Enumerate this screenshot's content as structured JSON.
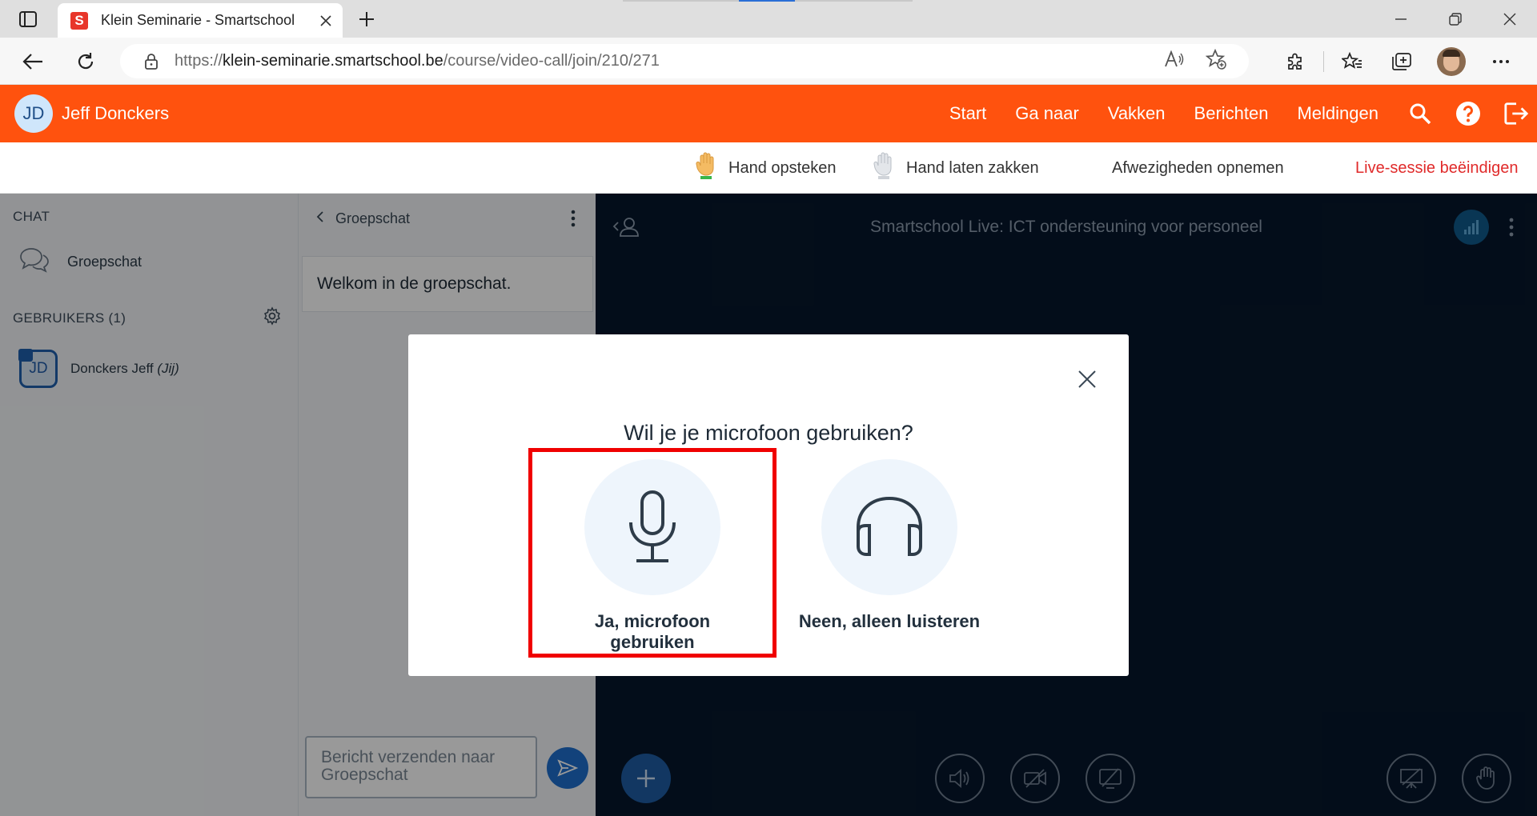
{
  "browser": {
    "tab_title": "Klein Seminarie - Smartschool",
    "favicon_letter": "S",
    "url_prefix": "https://",
    "url_host": "klein-seminarie.smartschool.be",
    "url_path": "/course/video-call/join/210/271"
  },
  "header": {
    "user_initials": "JD",
    "user_name": "Jeff Donckers",
    "nav": [
      "Start",
      "Ga naar",
      "Vakken",
      "Berichten",
      "Meldingen"
    ]
  },
  "session_bar": {
    "raise_hand": "Hand opsteken",
    "lower_hand": "Hand laten zakken",
    "absences": "Afwezigheden opnemen",
    "end_session": "Live-sessie beëindigen"
  },
  "left_panel": {
    "chat_title": "CHAT",
    "chat_entry": "Groepschat",
    "users_title": "GEBRUIKERS (1)",
    "user_initials": "JD",
    "user_name": "Donckers Jeff",
    "user_self": "(Jij)"
  },
  "chat_panel": {
    "title": "Groepschat",
    "welcome": "Welkom in de groepschat.",
    "input_placeholder": "Bericht verzenden naar Groepschat"
  },
  "stage": {
    "title": "Smartschool Live: ICT ondersteuning voor personeel"
  },
  "modal": {
    "question": "Wil je je microfoon gebruiken?",
    "option_mic": "Ja, microfoon gebruiken",
    "option_listen": "Neen, alleen luisteren"
  },
  "colors": {
    "brand": "#ff520e",
    "stage_bg": "#06172c",
    "highlight": "#f00000",
    "end_session": "#e02a2a"
  }
}
